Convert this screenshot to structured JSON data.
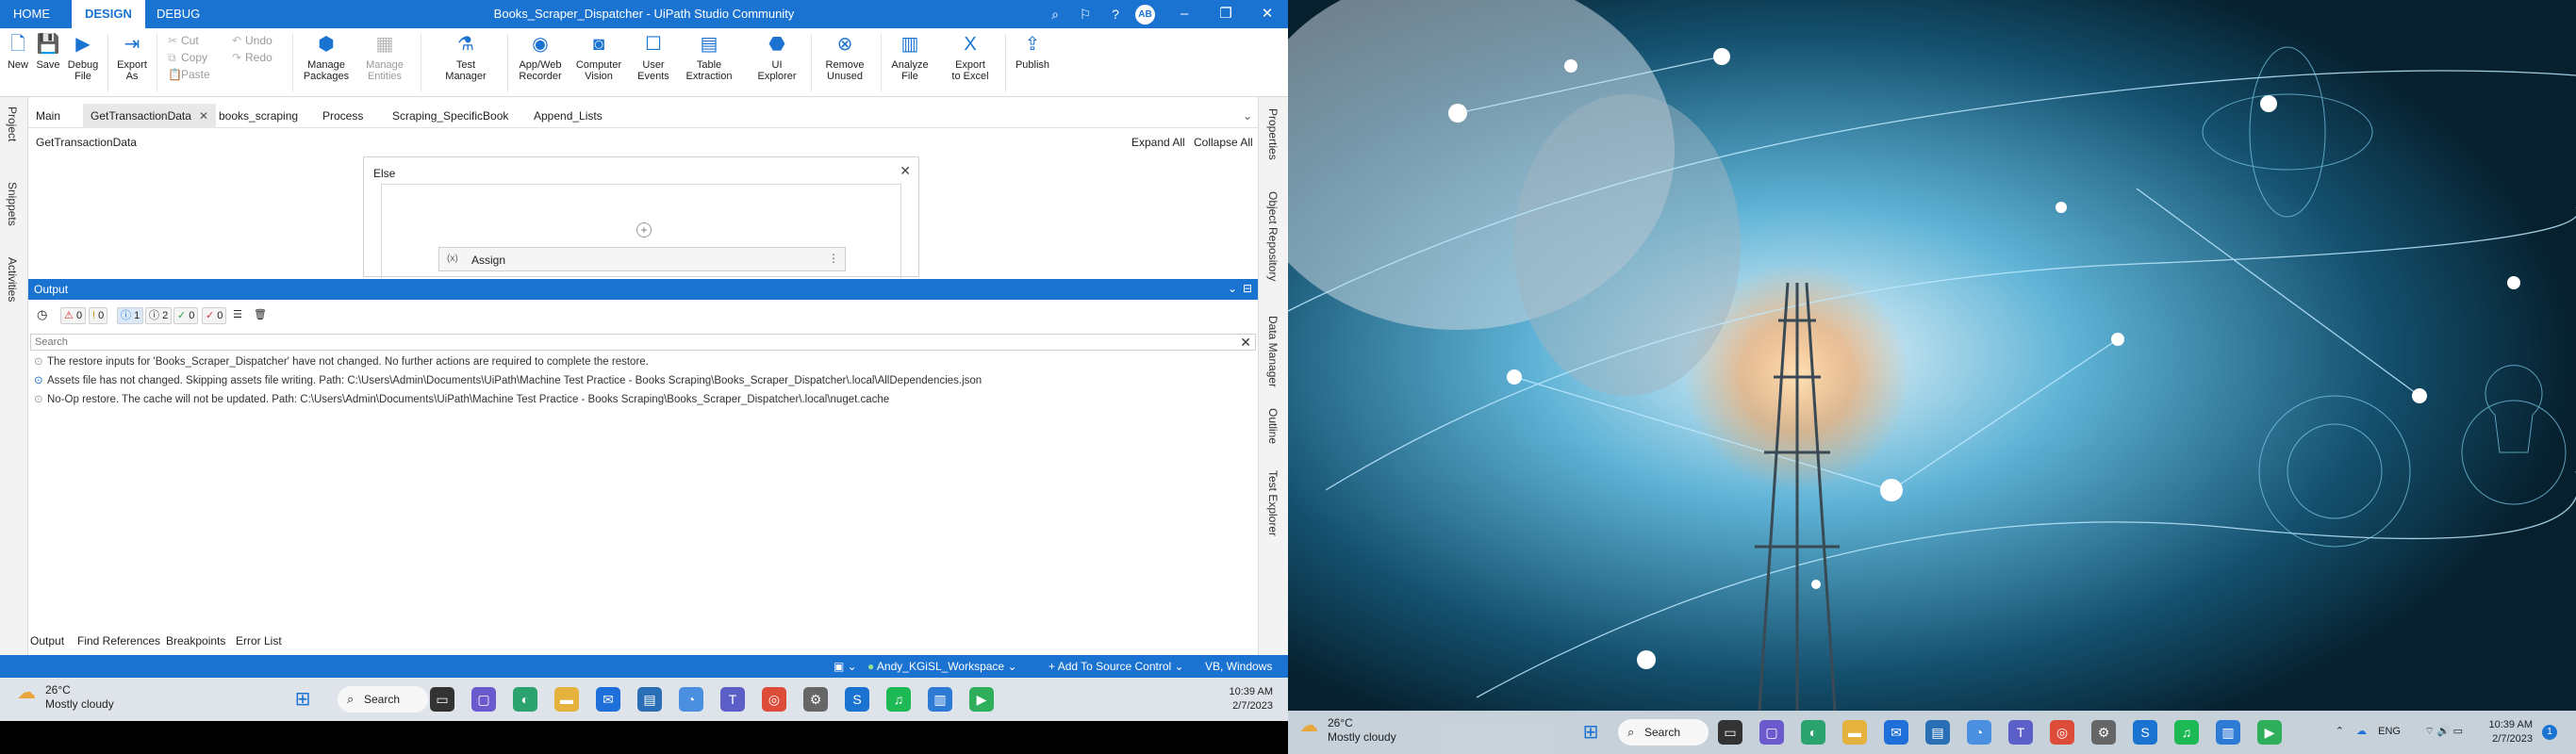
{
  "titlebar": {
    "tabs": [
      "HOME",
      "DESIGN",
      "DEBUG"
    ],
    "title": "Books_Scraper_Dispatcher - UiPath Studio Community",
    "avatar": "AB"
  },
  "ribbon": {
    "buttons": [
      {
        "label": "New",
        "icon": "new-file-icon"
      },
      {
        "label": "Save",
        "icon": "save-icon"
      },
      {
        "label": "Debug\nFile",
        "icon": "debug-play-icon"
      },
      {
        "label": "Export\nAs",
        "icon": "export-icon"
      },
      {
        "label": "Manage\nPackages",
        "icon": "packages-icon"
      },
      {
        "label": "Manage\nEntities",
        "icon": "entities-icon"
      },
      {
        "label": "Test\nManager",
        "icon": "test-manager-icon"
      },
      {
        "label": "App/Web\nRecorder",
        "icon": "recorder-icon"
      },
      {
        "label": "Computer\nVision",
        "icon": "computer-vision-icon"
      },
      {
        "label": "User\nEvents",
        "icon": "user-events-icon"
      },
      {
        "label": "Table\nExtraction",
        "icon": "table-extraction-icon"
      },
      {
        "label": "UI\nExplorer",
        "icon": "ui-explorer-icon"
      },
      {
        "label": "Remove\nUnused",
        "icon": "remove-unused-icon"
      },
      {
        "label": "Analyze\nFile",
        "icon": "analyze-icon"
      },
      {
        "label": "Export\nto Excel",
        "icon": "excel-icon"
      },
      {
        "label": "Publish",
        "icon": "publish-icon"
      }
    ],
    "clipboard": [
      "Cut",
      "Copy",
      "Paste"
    ],
    "history": [
      "Undo",
      "Redo"
    ]
  },
  "left_panels": [
    "Project",
    "Snippets",
    "Activities"
  ],
  "right_panels": [
    "Properties",
    "Object Repository",
    "Data Manager",
    "Outline",
    "Test Explorer"
  ],
  "doc_tabs": [
    "Main",
    "GetTransactionData",
    "books_scraping",
    "Process",
    "Scraping_SpecificBook",
    "Append_Lists"
  ],
  "breadcrumb": "GetTransactionData",
  "expand_all": "Expand All",
  "collapse_all": "Collapse All",
  "canvas": {
    "else_label": "Else",
    "activity_fx": "(x)",
    "activity_label": "Assign"
  },
  "output": {
    "title": "Output",
    "counts": {
      "errors": "0",
      "warnings": "0",
      "info": "1",
      "verbose": "2",
      "success": "0",
      "failed": "0"
    },
    "search_placeholder": "Search",
    "lines": [
      "The restore inputs for 'Books_Scraper_Dispatcher' have not changed. No further actions are required to complete the restore.",
      "Assets file has not changed. Skipping assets file writing. Path: C:\\Users\\Admin\\Documents\\UiPath\\Machine Test Practice - Books Scraping\\Books_Scraper_Dispatcher\\.local\\AllDependencies.json",
      "No-Op restore. The cache will not be updated. Path: C:\\Users\\Admin\\Documents\\UiPath\\Machine Test Practice - Books Scraping\\Books_Scraper_Dispatcher\\.local\\nuget.cache"
    ]
  },
  "bottom_tabs": [
    "Output",
    "Find References",
    "Breakpoints",
    "Error List"
  ],
  "statusbar": {
    "workspace": "Andy_KGiSL_Workspace",
    "source_control": "Add To Source Control",
    "language": "VB, Windows"
  },
  "taskbar": {
    "temp": "26°C",
    "condition": "Mostly cloudy",
    "search": "Search",
    "time": "10:39 AM",
    "date": "2/7/2023",
    "lang": "ENG",
    "notif": "1"
  },
  "colors": {
    "accent": "#1a73d1"
  }
}
